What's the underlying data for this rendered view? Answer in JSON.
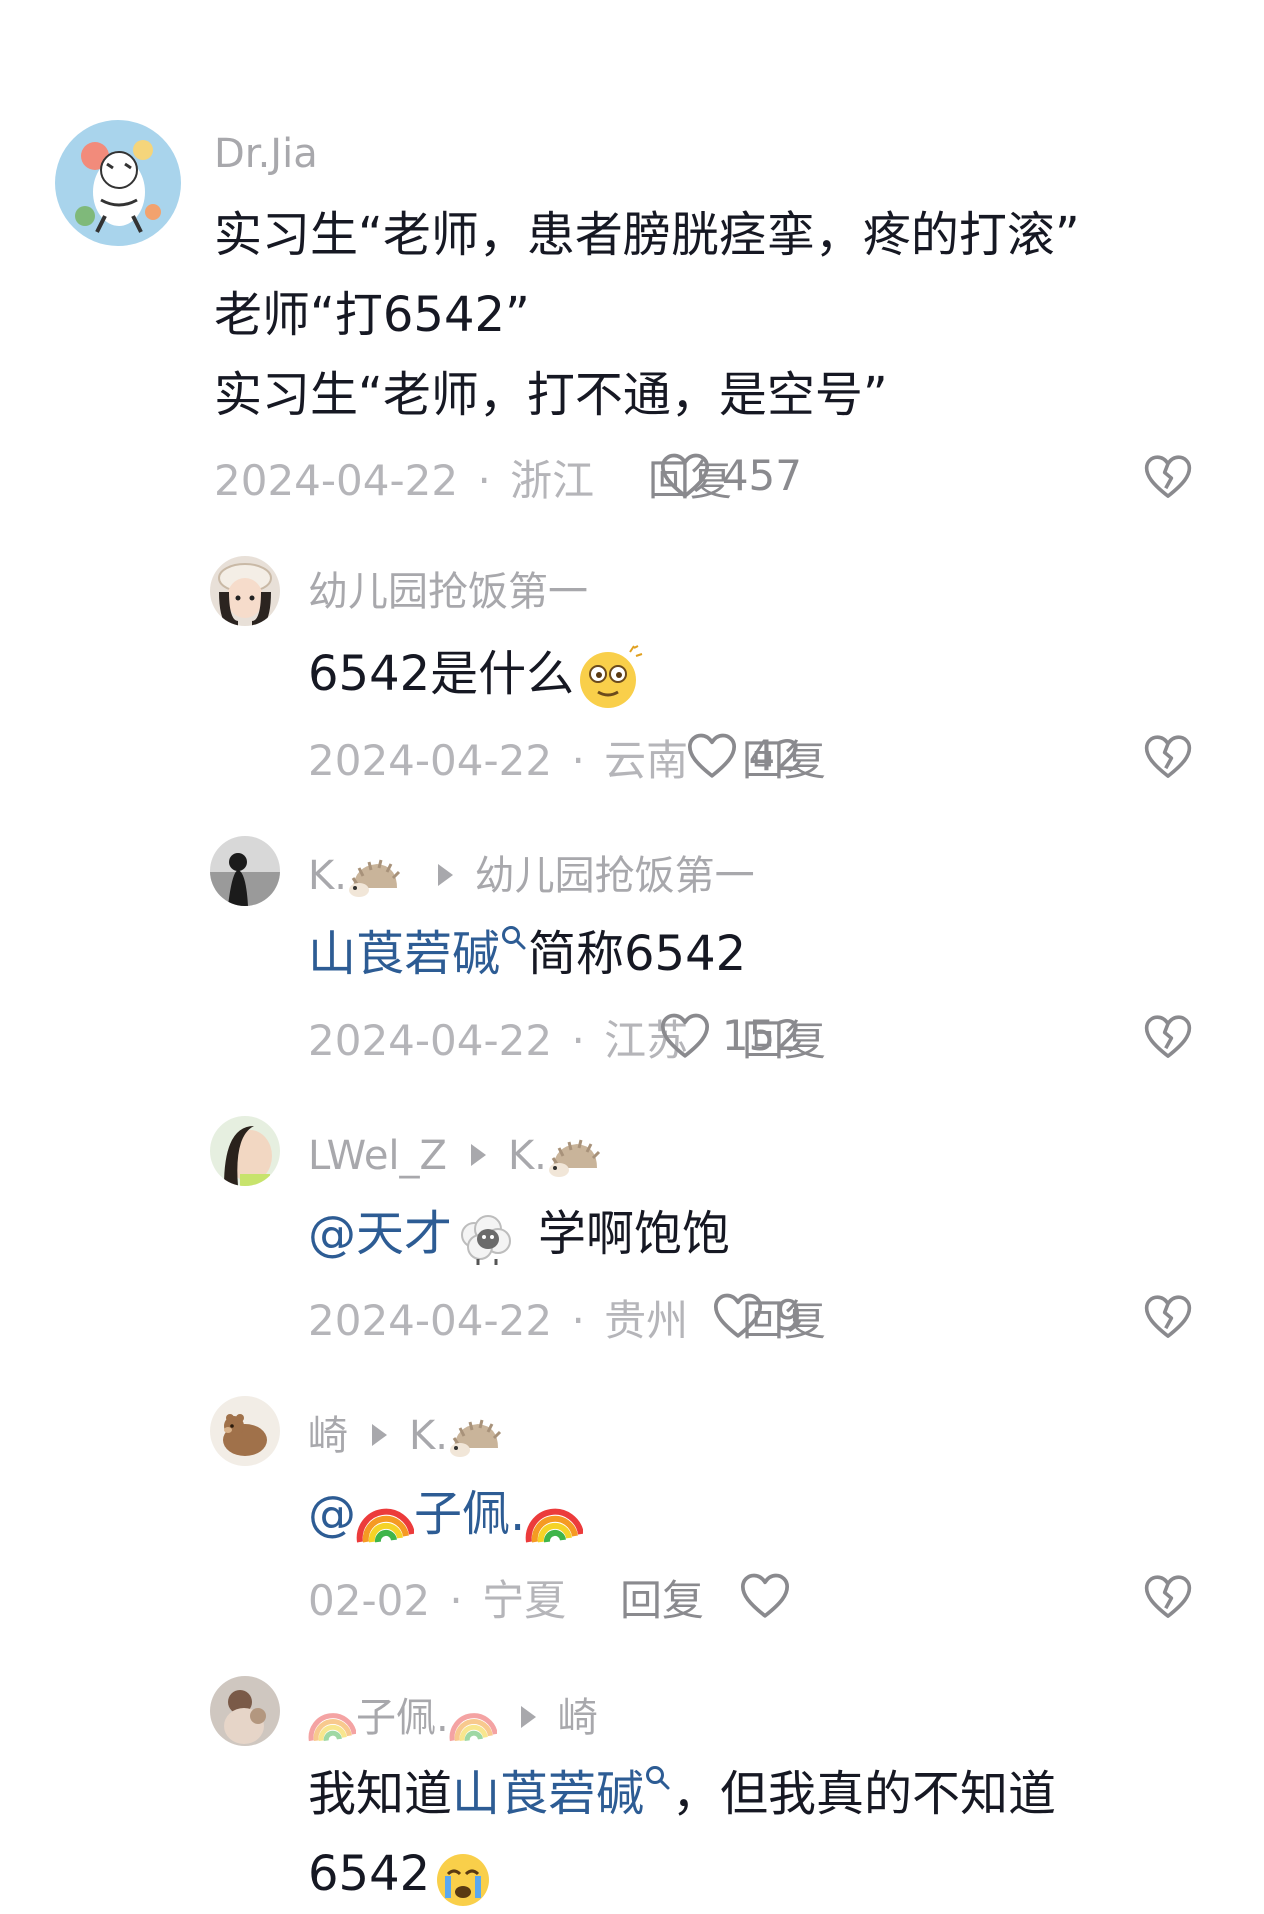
{
  "comments": [
    {
      "username": "Dr.Jia",
      "lines": [
        "实习生“老师，患者膀胱痉挛，疼的打滚”",
        "老师“打6542”",
        "实习生“老师，打不通，是空号”"
      ],
      "date": "2024-04-22",
      "location": "浙江",
      "reply_label": "回复",
      "likes": "457"
    },
    {
      "username": "幼儿园抢饭第一",
      "text": "6542是什么",
      "date": "2024-04-22",
      "location": "云南",
      "reply_label": "回复",
      "likes": "42"
    },
    {
      "username": "K.",
      "reply_to": "幼儿园抢饭第一",
      "link": "山莨菪碱",
      "text": "简称6542",
      "date": "2024-04-22",
      "location": "江苏",
      "reply_label": "回复",
      "likes": "152"
    },
    {
      "username": "LWel_Z",
      "reply_to": "K.",
      "mention": "@天才",
      "text": "学啊饱饱",
      "date": "2024-04-22",
      "location": "贵州",
      "reply_label": "回复",
      "likes": "9"
    },
    {
      "username": "崎",
      "reply_to": "K.",
      "mention_prefix": "@",
      "mention_name": "子佩.",
      "date": "02-02",
      "location": "宁夏",
      "reply_label": "回复",
      "likes": ""
    },
    {
      "username": "子佩.",
      "reply_to": "崎",
      "text_before": "我知道",
      "link": "山莨菪碱",
      "text_after": "，但我真的不知道",
      "text_line2": "6542"
    }
  ],
  "separator": "·",
  "colors": {
    "text": "#161823",
    "username": "#a8a8ac",
    "meta": "#b5b5b9",
    "link": "#2d5c94",
    "icon": "#8a8a8e"
  },
  "icons": [
    "heart-outline-icon",
    "broken-heart-icon",
    "search-link-icon",
    "reply-arrow-icon"
  ]
}
